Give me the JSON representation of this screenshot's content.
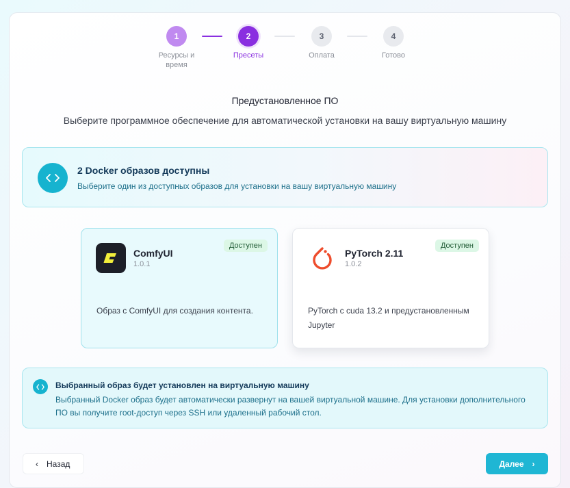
{
  "stepper": {
    "steps": [
      {
        "num": "1",
        "label": "Ресурсы и время",
        "state": "done"
      },
      {
        "num": "2",
        "label": "Пресеты",
        "state": "active"
      },
      {
        "num": "3",
        "label": "Оплата",
        "state": "todo"
      },
      {
        "num": "4",
        "label": "Готово",
        "state": "todo"
      }
    ]
  },
  "header": {
    "title": "Предустановленное ПО",
    "subtitle": "Выберите программное обеспечение для автоматической установки на вашу виртуальную машину"
  },
  "info_banner": {
    "icon": "code-icon",
    "title": "2 Docker образов доступны",
    "text": "Выберите один из доступных образов для установки на вашу виртуальную машину"
  },
  "images": [
    {
      "name": "ComfyUI",
      "version": "1.0.1",
      "badge": "Доступен",
      "description": "Образ с ComfyUI для создания контента.",
      "selected": true,
      "icon": "comfyui-logo-icon"
    },
    {
      "name": "PyTorch 2.11",
      "version": "1.0.2",
      "badge": "Доступен",
      "description": "PyTorch с cuda 13.2 и предустановленным Jupyter",
      "selected": false,
      "icon": "pytorch-logo-icon"
    }
  ],
  "note": {
    "icon": "code-icon",
    "title": "Выбранный образ будет установлен на виртуальную машину",
    "text": "Выбранный Docker образ будет автоматически развернут на вашей виртуальной машине. Для установки дополнительного ПО вы получите root-доступ через SSH или удаленный рабочий стол."
  },
  "footer": {
    "back_label": "Назад",
    "next_label": "Далее"
  },
  "colors": {
    "accent_purple": "#8a2fe0",
    "accent_cyan": "#1fb6d4",
    "badge_green": "#dcf7e6"
  }
}
